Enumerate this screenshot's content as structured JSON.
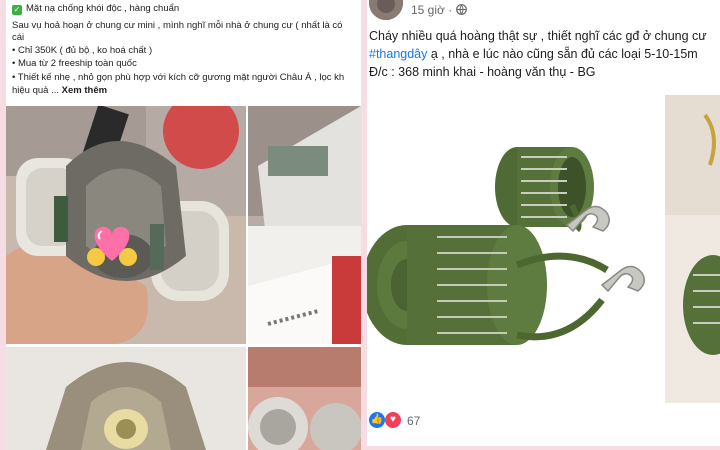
{
  "left_post": {
    "line1": "Mặt nạ chống khói độc , hàng chuẩn",
    "line2": "Sau vụ hoả hoạn ở chung cư mini , mình nghĩ mỗi nhà ở chung cư ( nhất là có",
    "line3": "cái",
    "bullet1": "• Chỉ 350K ( đủ bộ , ko hoá chất )",
    "bullet2": "• Mua từ 2 freeship toàn quốc",
    "bullet3": "• Thiết kế nhẹ , nhỏ gọn phù hợp với kích cỡ gương mặt người Châu Á , lọc kh",
    "line_last": "hiệu quả ...",
    "see_more": "Xem thêm",
    "check_glyph": "✓"
  },
  "right_post": {
    "time": "15 giờ ·",
    "line1": "Cháy nhiều quá hoàng thật sự , thiết nghĩ các gđ ở chung cư",
    "hashtag": "#thangdây",
    "line2_rest": " ạ , nhà e lúc nào cũng sẵn đủ các loại 5-10-15m",
    "line3": "Đ/c : 368 minh khai - hoàng văn thụ - BG",
    "reaction_count": "67",
    "like_glyph": "👍",
    "love_glyph": "♥"
  },
  "colors": {
    "background": "#f6dce3",
    "link": "#1877f2",
    "like": "#1877f2",
    "love": "#f33e58",
    "check": "#3cb043",
    "ladder_green": "#56703a"
  },
  "icons": {
    "globe": "globe-icon",
    "like": "like-icon",
    "love": "love-icon",
    "check": "check-icon",
    "heart_sticker": "heart-sticker-icon"
  }
}
